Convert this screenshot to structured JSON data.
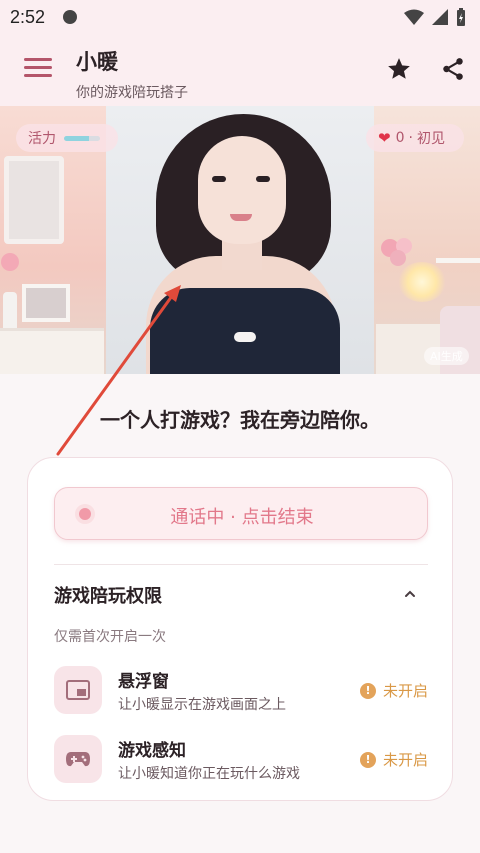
{
  "status_bar": {
    "time": "2:52"
  },
  "app": {
    "title": "小暖",
    "subtitle": "你的游戏陪玩搭子"
  },
  "hero": {
    "vitality_label": "活力",
    "vitality_level": 0.7,
    "intimacy_count": "0",
    "intimacy_separator": "·",
    "intimacy_label": "初见",
    "ai_badge": "AI生成"
  },
  "tagline": "一个人打游戏？我在旁边陪你。",
  "call": {
    "label": "通话中 · 点击结束"
  },
  "permissions": {
    "title": "游戏陪玩权限",
    "subtitle": "仅需首次开启一次",
    "items": [
      {
        "name": "悬浮窗",
        "desc": "让小暖显示在游戏画面之上",
        "status": "未开启",
        "icon": "floating-window-icon"
      },
      {
        "name": "游戏感知",
        "desc": "让小暖知道你正在玩什么游戏",
        "status": "未开启",
        "icon": "gamepad-icon"
      }
    ]
  },
  "colors": {
    "accent": "#e2788a",
    "warning": "#d99846",
    "background": "#faf6f7",
    "annotation_arrow": "#e04a3a"
  }
}
